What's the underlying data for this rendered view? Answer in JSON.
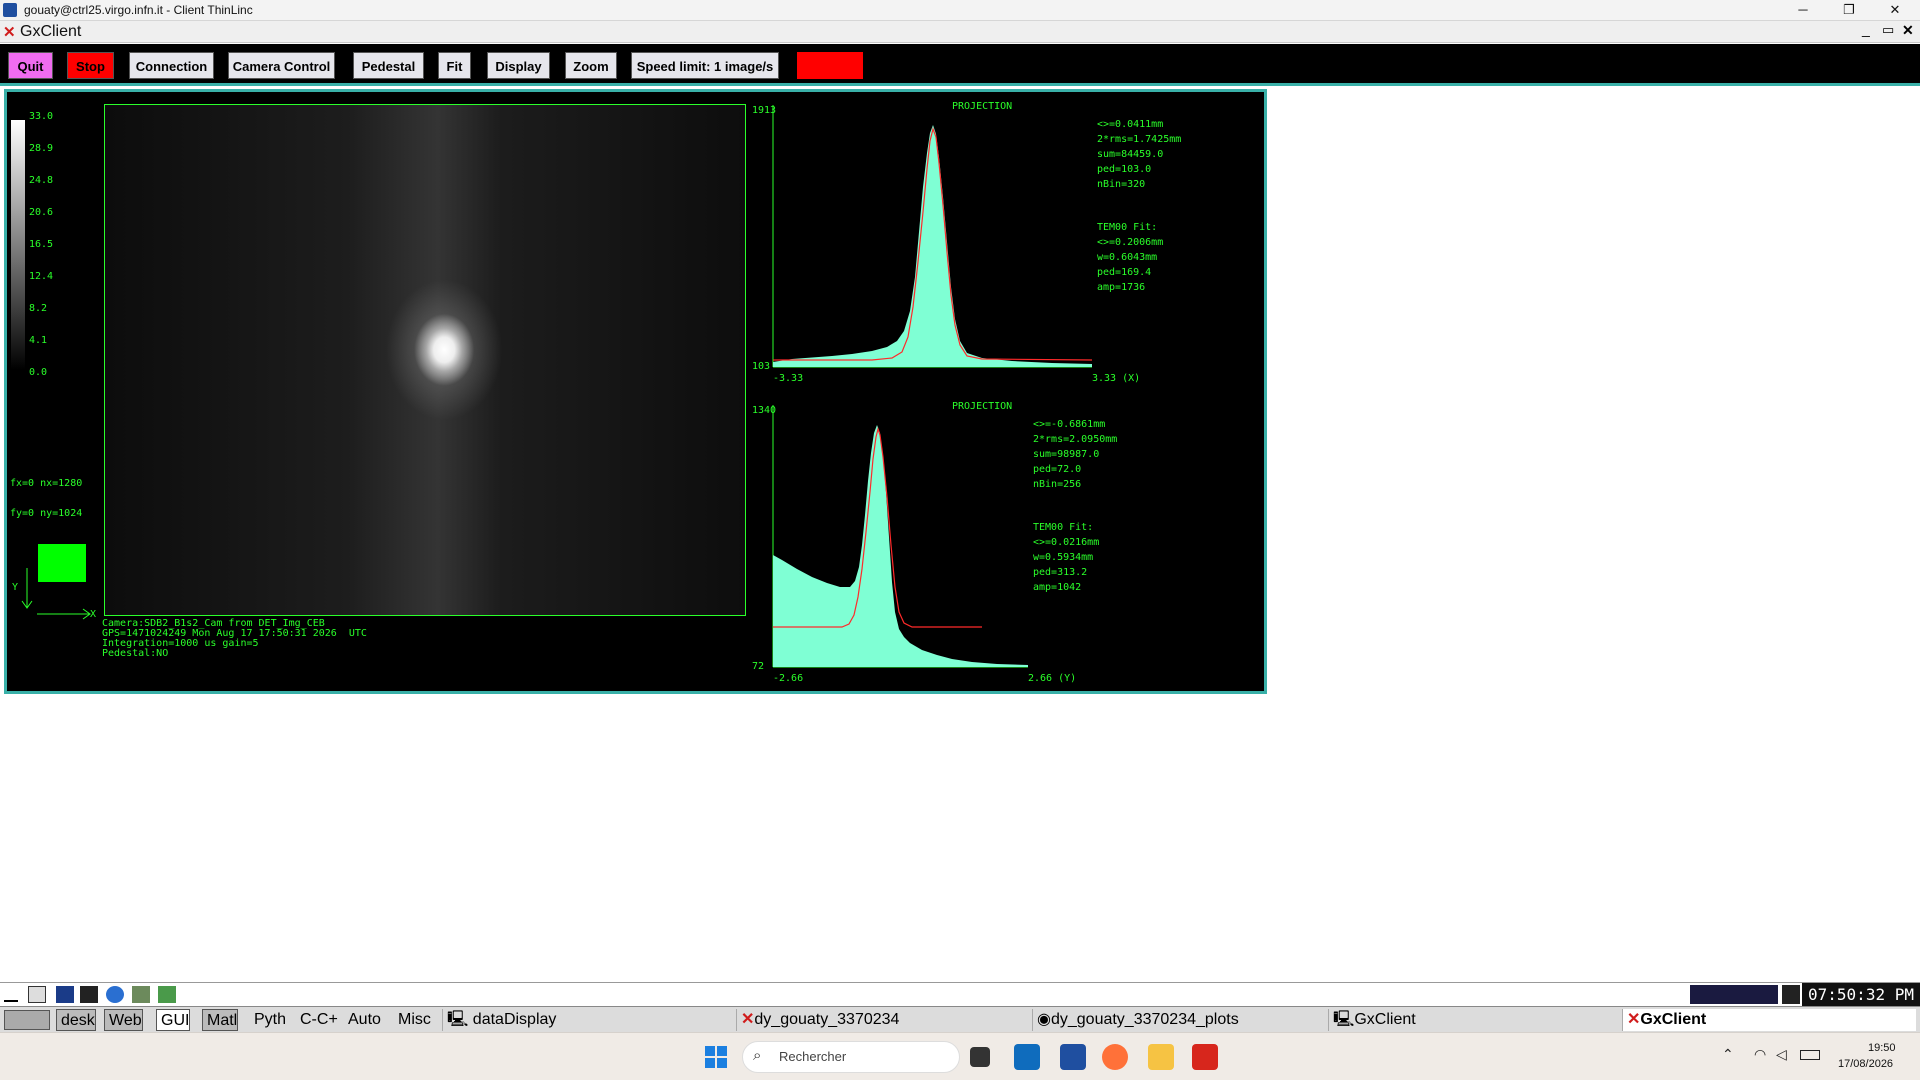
{
  "window": {
    "title": "gouaty@ctrl25.virgo.infn.it - Client ThinLinc",
    "minimize": "─",
    "maximize": "❐",
    "close": "✕"
  },
  "app": {
    "title": "GxClient",
    "min": "_",
    "restore": "▭",
    "close": "✕"
  },
  "toolbar": {
    "quit": "Quit",
    "stop": "Stop",
    "connection": "Connection",
    "camera_control": "Camera Control",
    "pedestal": "Pedestal",
    "fit": "Fit",
    "display": "Display",
    "zoom": "Zoom",
    "speed_limit": "Speed limit: 1 image/s",
    "colors": {
      "quit": "#f06cf0",
      "stop": "#ff0000",
      "indicator": "#ff0000"
    }
  },
  "colorscale": {
    "ticks": [
      "33.0",
      "28.9",
      "24.8",
      "20.6",
      "16.5",
      "12.4",
      "8.2",
      "4.1",
      "0.0"
    ]
  },
  "image": {
    "fx": "fx=0 nx=1280",
    "fy": "fy=0 ny=1024",
    "axis_x": "X",
    "axis_y": "Y"
  },
  "info": {
    "camera": "Camera:SDB2_B1s2_Cam from DET_Img_CEB",
    "gps": "GPS=1471024249 Mon Aug 17 17:50:31 2026  UTC",
    "integration": "Integration=1000 us gain=5",
    "pedestal": "Pedestal:NO"
  },
  "projection_x": {
    "title": "PROJECTION",
    "ymax": "1913",
    "ymin": "103",
    "xmin": "-3.33",
    "xmax": "3.33 (X)",
    "stats": [
      "<>=0.0411mm",
      "2*rms=1.7425mm",
      "sum=84459.0",
      "ped=103.0",
      "nBin=320"
    ],
    "fit": [
      "TEM00 Fit:",
      "<>=0.2006mm",
      "w=0.6043mm",
      "ped=169.4",
      "amp=1736"
    ]
  },
  "projection_y": {
    "title": "PROJECTION",
    "ymax": "1340",
    "ymin": "72",
    "xmin": "-2.66",
    "xmax": "2.66 (Y)",
    "stats": [
      "<>=-0.6861mm",
      "2*rms=2.0950mm",
      "sum=98987.0",
      "ped=72.0",
      "nBin=256"
    ],
    "fit": [
      "TEM00 Fit:",
      "<>=0.0216mm",
      "w=0.5934mm",
      "ped=313.2",
      "amp=1042"
    ]
  },
  "xbar": {
    "clock": "07:50:32 PM",
    "menus": [
      "desk",
      "Web",
      "GUI",
      "Matl",
      "Pyth",
      "C-C+",
      "Auto",
      "Misc"
    ],
    "tasks": [
      "dataDisplay",
      "dy_gouaty_3370234",
      "dy_gouaty_3370234_plots",
      "GxClient",
      "GxClient"
    ]
  },
  "taskbar": {
    "search_placeholder": "Rechercher",
    "time": "19:50",
    "date": "17/08/2026"
  }
}
